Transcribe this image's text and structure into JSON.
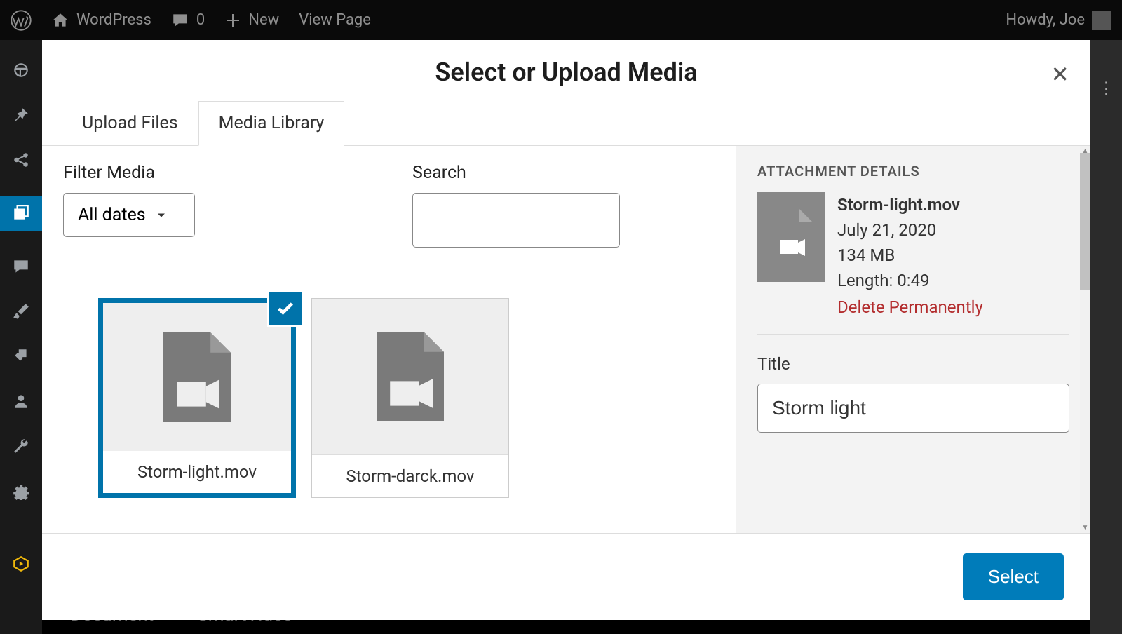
{
  "adminbar": {
    "site_name": "WordPress",
    "comments_count": "0",
    "new_label": "New",
    "view_page": "View Page",
    "howdy": "Howdy, Joe"
  },
  "modal": {
    "title": "Select or Upload Media",
    "tabs": {
      "upload": "Upload Files",
      "library": "Media Library"
    },
    "filter_label": "Filter Media",
    "date_filter": "All dates",
    "search_label": "Search",
    "search_value": "",
    "select_button": "Select"
  },
  "media_items": [
    {
      "filename": "Storm-light.mov",
      "selected": true
    },
    {
      "filename": "Storm-darck.mov",
      "selected": false
    }
  ],
  "attachment": {
    "heading": "ATTACHMENT DETAILS",
    "filename": "Storm-light.mov",
    "date": "July 21, 2020",
    "size": "134 MB",
    "length": "Length: 0:49",
    "delete": "Delete Permanently",
    "title_label": "Title",
    "title_value": "Storm light"
  },
  "breadcrumb": {
    "root": "Document",
    "arrow": "→",
    "current": "SmartVideo"
  }
}
